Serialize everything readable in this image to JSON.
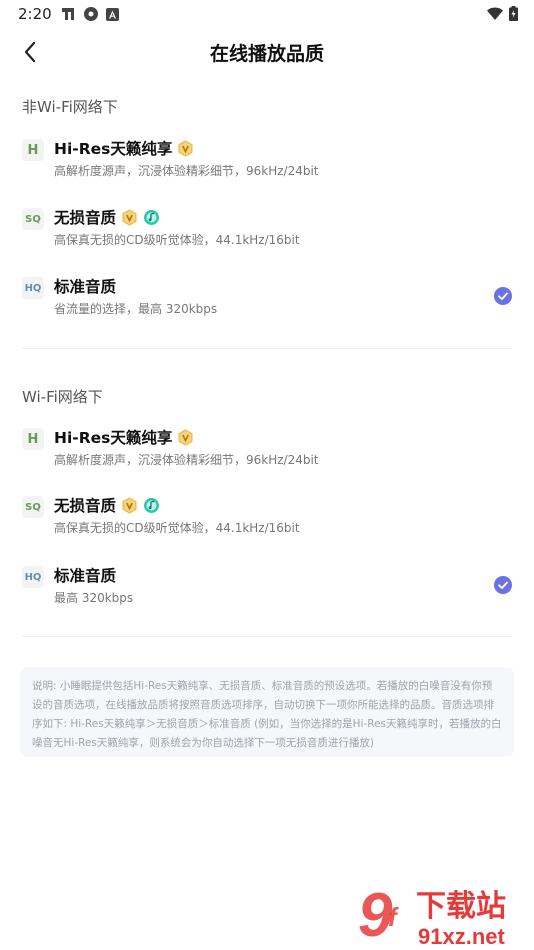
{
  "status_bar": {
    "time": "2:20"
  },
  "header": {
    "title": "在线播放品质"
  },
  "sections": [
    {
      "label": "非Wi-Fi网络下",
      "options": [
        {
          "badge": "H",
          "name": "Hi-Res天籁纯享",
          "desc": "高解析度源声，沉浸体验精彩细节，96kHz/24bit",
          "tags": [
            "vip-icon"
          ],
          "selected": false
        },
        {
          "badge": "SQ",
          "name": "无损音质",
          "desc": "高保真无损的CD级听觉体验，44.1kHz/16bit",
          "tags": [
            "vip-icon",
            "music-icon"
          ],
          "selected": false
        },
        {
          "badge": "HQ",
          "name": "标准音质",
          "desc": "省流量的选择，最高 320kbps",
          "tags": [],
          "selected": true
        }
      ]
    },
    {
      "label": "Wi-Fi网络下",
      "options": [
        {
          "badge": "H",
          "name": "Hi-Res天籁纯享",
          "desc": "高解析度源声，沉浸体验精彩细节，96kHz/24bit",
          "tags": [
            "vip-icon"
          ],
          "selected": false
        },
        {
          "badge": "SQ",
          "name": "无损音质",
          "desc": "高保真无损的CD级听觉体验，44.1kHz/16bit",
          "tags": [
            "vip-icon",
            "music-icon"
          ],
          "selected": false
        },
        {
          "badge": "HQ",
          "name": "标准音质",
          "desc": "最高 320kbps",
          "tags": [],
          "selected": true
        }
      ]
    }
  ],
  "note": "说明: 小睡眠提供包括Hi-Res天籁纯享、无损音质、标准音质的预设选项。若播放的白噪音没有你预设的音质选项，在线播放品质将按照音质选项排序，自动切换下一项你所能选择的品质。音质选项排序如下: Hi-Res天籁纯享＞无损音质＞标准音质 (例如，当你选择的是Hi-Res天籁纯享时，若播放的白噪音无Hi-Res天籁纯享，则系统会为你自动选择下一项无损音质进行播放)",
  "watermark": {
    "brand": "下载站",
    "domain": "91xz.net"
  },
  "colors": {
    "accent": "#6b72e4",
    "vip_gold": "#e8b43a",
    "music_teal": "#2cc6b0"
  }
}
